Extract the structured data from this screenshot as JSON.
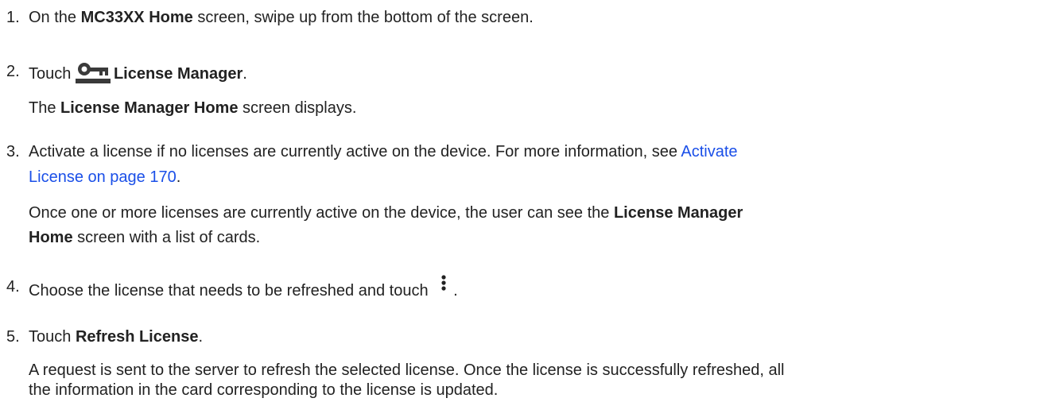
{
  "steps": [
    {
      "number": "1.",
      "pre": "On the ",
      "bold": "MC33XX Home",
      "post": " screen, swipe up from the bottom of the screen."
    },
    {
      "number": "2.",
      "pre": "Touch ",
      "icon": "license-manager-app-icon",
      "bold": "License Manager",
      "post": ".",
      "result_bold": "License Manager Home",
      "result_post": " screen displays.",
      "result_pre": "The "
    },
    {
      "number": "3.",
      "text": "Activate a license if no licenses are currently active on the device. For more information, see ",
      "link_line1": "Activate",
      "link_line2": "License on page 170",
      "post": ".",
      "result_pre": "Once one or more licenses are currently active on the device, the user can see the ",
      "result_bold1": "License Manager",
      "result_bold2": "Home",
      "result_post": " screen with a list of cards."
    },
    {
      "number": "4.",
      "text": "Choose the license that needs to be refreshed and touch ",
      "icon": "more-options-icon",
      "post": "."
    },
    {
      "number": "5.",
      "pre": "Touch ",
      "bold": "Refresh License",
      "post": ".",
      "result_line1": "A request is sent to the server to refresh the selected license. Once the license is successfully refreshed, all",
      "result_line2": "the information in the card corresponding to the license is updated."
    }
  ],
  "colors": {
    "text": "#222222",
    "link": "#1a4fe8"
  }
}
